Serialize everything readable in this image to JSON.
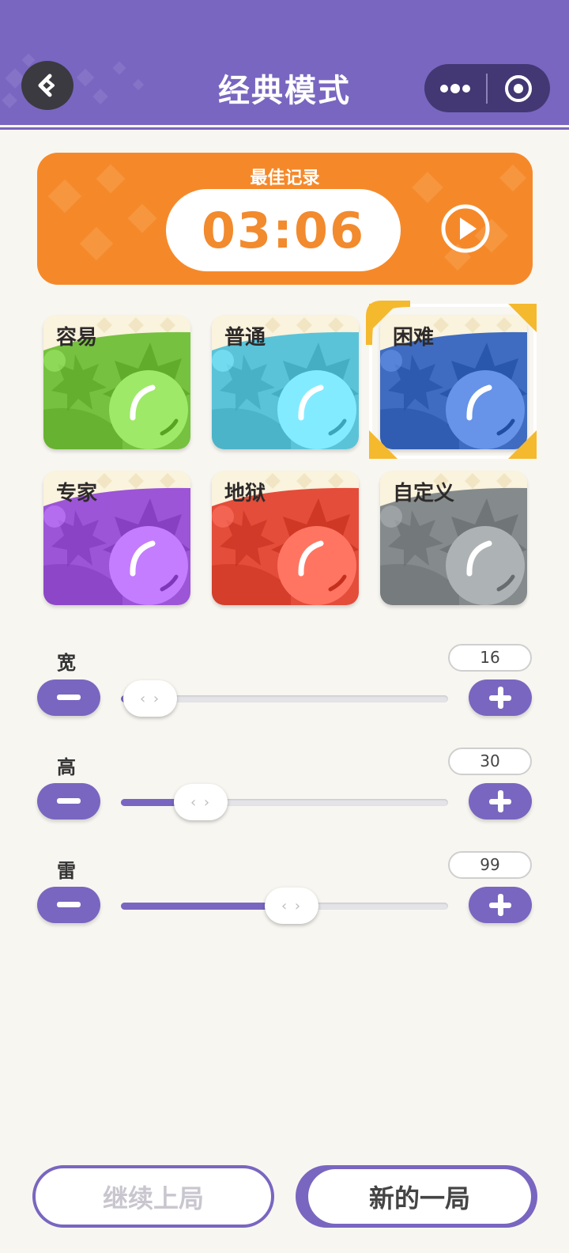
{
  "header": {
    "title": "经典模式",
    "back_icon": "back-arrow-icon",
    "more_icon": "more-dots-icon",
    "target_icon": "target-icon",
    "color": "#7966c0"
  },
  "best_record": {
    "label": "最佳记录",
    "time": "03:06",
    "play_icon": "play-icon",
    "color": "#f5892a"
  },
  "modes": [
    {
      "label": "容易",
      "color": "#76c140",
      "selected": false
    },
    {
      "label": "普通",
      "color": "#5bc3d8",
      "selected": false
    },
    {
      "label": "困难",
      "color": "#3f6cc0",
      "selected": true
    },
    {
      "label": "专家",
      "color": "#9c55d6",
      "selected": false
    },
    {
      "label": "地狱",
      "color": "#e34d3a",
      "selected": false
    },
    {
      "label": "自定义",
      "color": "#858b8c",
      "selected": false
    }
  ],
  "settings": {
    "width": {
      "label": "宽",
      "value": "16"
    },
    "height": {
      "label": "高",
      "value": "30"
    },
    "mines": {
      "label": "雷",
      "value": "99"
    }
  },
  "buttons": {
    "continue_label": "继续上局",
    "new_label": "新的一局"
  }
}
